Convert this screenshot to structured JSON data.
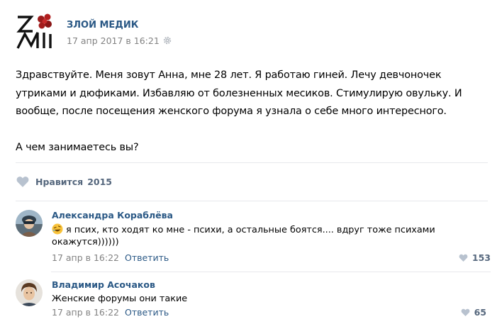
{
  "post": {
    "author": "ЗЛОЙ МЕДИК",
    "date": "17 апр 2017 в 16:21",
    "text_lines": [
      "Здравствуйте. Меня зовут Анна, мне 28 лет. Я работаю гиней. Лечу девчоночек",
      "утриками и дюфиками. Избавляю от болезненных месиков. Стимулирую овульку. И",
      "вообще, после посещения женского форума я узнала о себе много интересного.",
      "А чем занимаетесь вы?"
    ],
    "like_label": "Нравится",
    "like_count": "2015"
  },
  "comments": [
    {
      "author": "Александра Кораблёва",
      "emoji": "rolling-on-floor-laughing-emoji",
      "text_lines": [
        "я псих, кто ходят ко мне - психи, а остальные боятся.... вдруг тоже психами",
        "окажутся))))))"
      ],
      "date": "17 апр в 16:22",
      "reply_label": "Ответить",
      "likes": "153"
    },
    {
      "author": "Владимир Асочаков",
      "text": "Женские форумы они такие",
      "date": "17 апр в 16:22",
      "reply_label": "Ответить",
      "likes": "65"
    }
  ],
  "icons": {
    "logo": "zm-logo-icon",
    "settings": "gear-icon",
    "like": "heart-icon"
  },
  "colors": {
    "link": "#2a5885",
    "meta": "#828282",
    "like": "#55677d",
    "heart": "#b8c2cf",
    "divider": "#e7e8ec"
  }
}
